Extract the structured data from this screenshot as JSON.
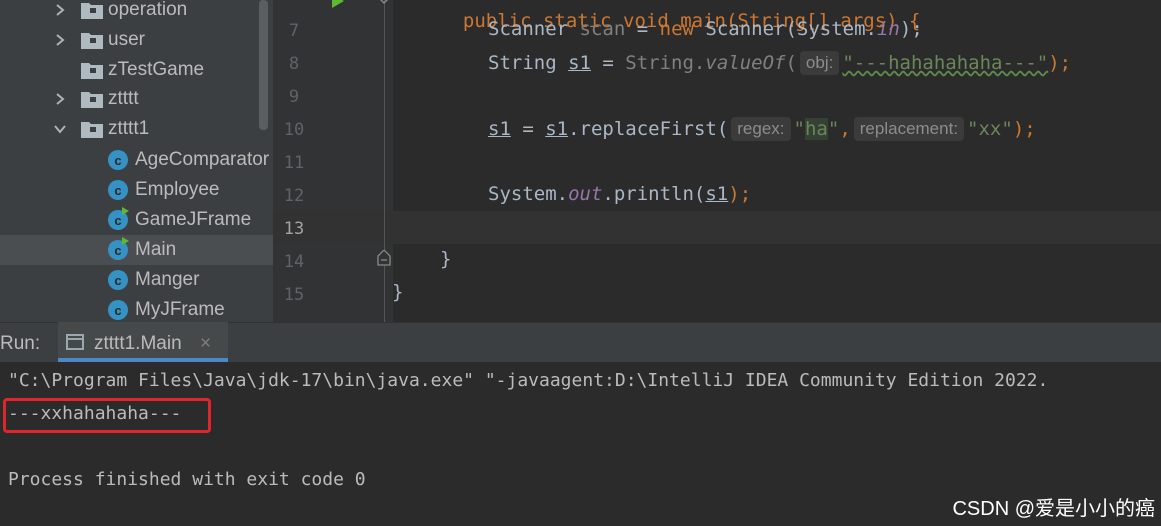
{
  "project_tree": [
    {
      "label": "operation",
      "type": "folder",
      "expandable": true
    },
    {
      "label": "user",
      "type": "folder",
      "expandable": true
    },
    {
      "label": "zTestGame",
      "type": "folder",
      "expandable": false
    },
    {
      "label": "ztttt",
      "type": "folder",
      "expandable": true
    },
    {
      "label": "ztttt1",
      "type": "folder",
      "expandable": true,
      "expanded": true
    },
    {
      "label": "AgeComparator",
      "type": "class"
    },
    {
      "label": "Employee",
      "type": "class"
    },
    {
      "label": "GameJFrame",
      "type": "class-runnable"
    },
    {
      "label": "Main",
      "type": "class-runnable",
      "selected": true
    },
    {
      "label": "Manger",
      "type": "class"
    },
    {
      "label": "MyJFrame",
      "type": "class"
    }
  ],
  "class_icon_letter": "c",
  "line_numbers": [
    "7",
    "8",
    "9",
    "10",
    "11",
    "12",
    "13",
    "14",
    "15"
  ],
  "current_line": "13",
  "code": {
    "line6": "public static void main(String[] args) {",
    "line7": {
      "type": "Scanner",
      "var": "scan",
      "op": " = ",
      "kw": "new",
      "ctor": " Scanner(System.",
      "field": "in",
      "end": ");"
    },
    "line8": {
      "type": "String ",
      "var": "s1",
      "op": " = ",
      "cls": "String.",
      "method": "valueOf",
      "open": "(",
      "hint": "obj:",
      "str": "\"---hahahahaha---\"",
      "end": ");"
    },
    "line10": {
      "var": "s1",
      "op": " = ",
      "var2": "s1",
      "call": ".replaceFirst(",
      "hint1": "regex:",
      "q1": "\"",
      "s1": "ha",
      "q2": "\"",
      "comma": ",",
      "hint2": "replacement:",
      "str2": "\"xx\"",
      "end": ");"
    },
    "line12": {
      "pre": "System.",
      "field": "out",
      "call": ".println(",
      "arg": "s1",
      "end": ");"
    },
    "line14": "}",
    "line15": "}"
  },
  "run": {
    "label": "Run:",
    "tab_title": "ztttt1.Main",
    "close": "×",
    "output": [
      "\"C:\\Program Files\\Java\\jdk-17\\bin\\java.exe\" \"-javaagent:D:\\IntelliJ IDEA Community Edition 2022.",
      "---xxhahahaha---",
      "",
      "Process finished with exit code 0"
    ]
  },
  "watermark": "CSDN @爱是小小的癌",
  "colors": {
    "highlight_box": "#e0252b",
    "accent": "#4a88c7",
    "class_icon": "#3592c4"
  }
}
